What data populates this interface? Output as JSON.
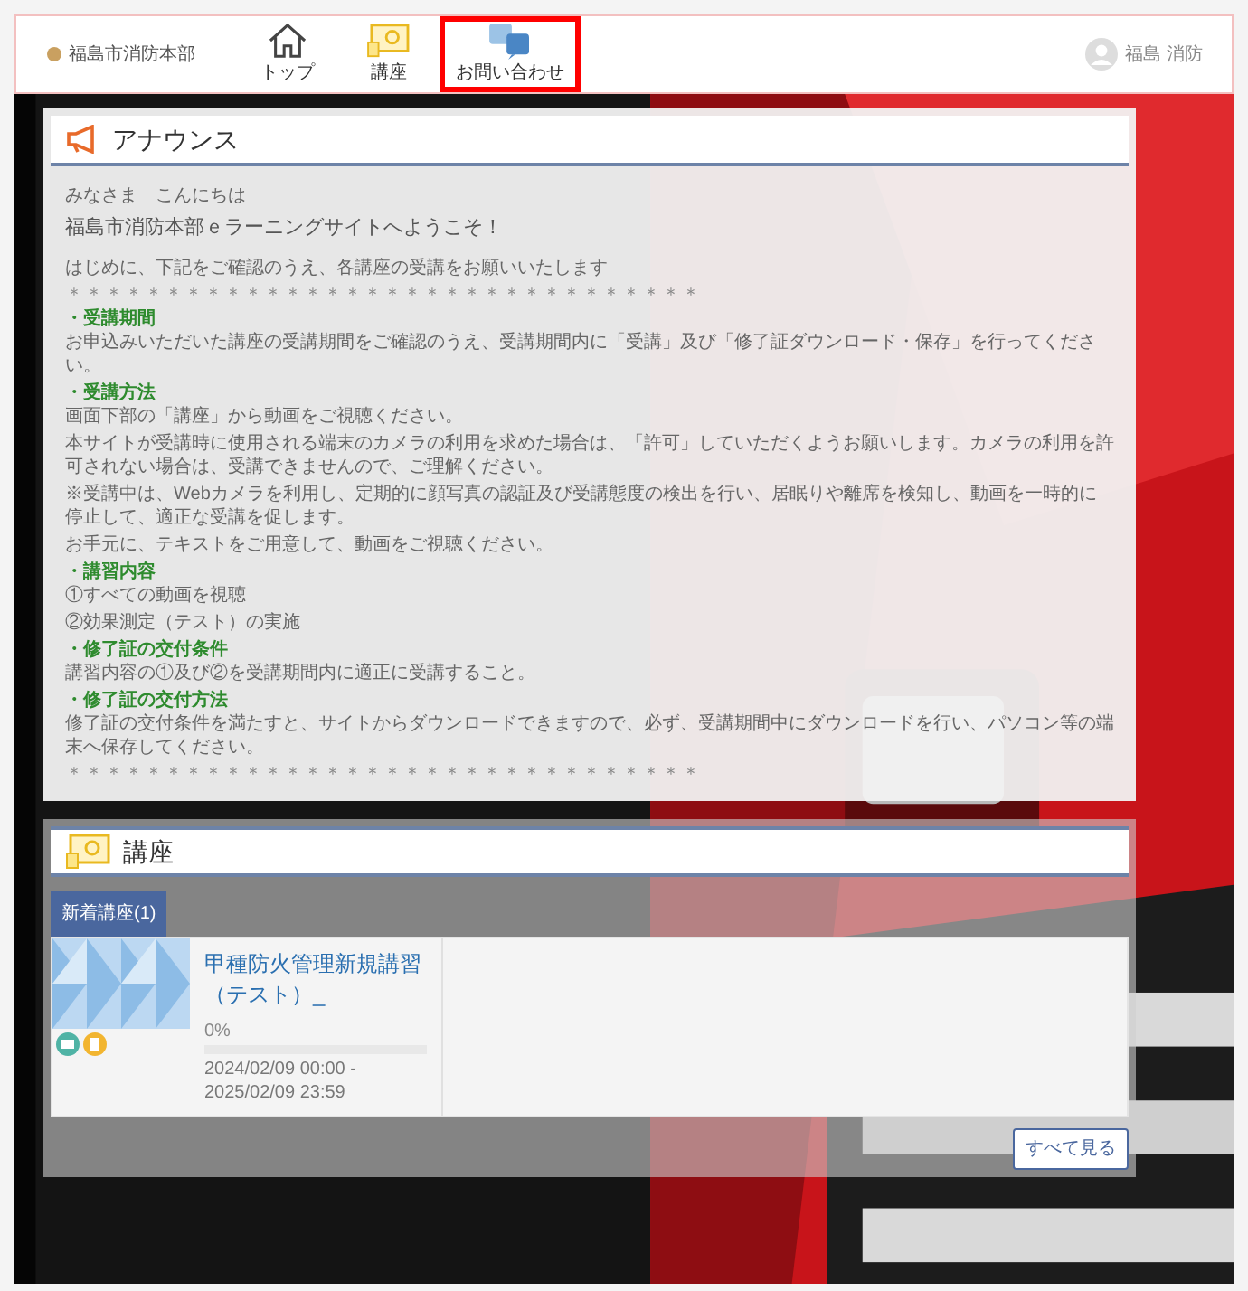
{
  "header": {
    "logo_text": "福島市消防本部",
    "nav": [
      {
        "label": "トップ",
        "kind": "home",
        "selected": false
      },
      {
        "label": "講座",
        "kind": "course",
        "selected": false
      },
      {
        "label": "お問い合わせ",
        "kind": "qa",
        "selected": true
      }
    ],
    "user": "福島 消防"
  },
  "announcement": {
    "title": "アナウンス",
    "blocks": [
      {
        "kind": "text",
        "text": "みなさま　こんにちは"
      },
      {
        "kind": "lead",
        "text": "福島市消防本部ｅラーニングサイトへようこそ！"
      },
      {
        "kind": "text",
        "text": "はじめに、下記をご確認のうえ、各講座の受講をお願いいたします"
      },
      {
        "kind": "stars",
        "text": "＊＊＊＊＊＊＊＊＊＊＊＊＊＊＊＊＊＊＊＊＊＊＊＊＊＊＊＊＊＊＊＊"
      },
      {
        "kind": "heading",
        "text": "・受講期間"
      },
      {
        "kind": "text",
        "text": "お申込みいただいた講座の受講期間をご確認のうえ、受講期間内に「受講」及び「修了証ダウンロード・保存」を行ってください。"
      },
      {
        "kind": "heading",
        "text": "・受講方法"
      },
      {
        "kind": "text",
        "text": "画面下部の「講座」から動画をご視聴ください。"
      },
      {
        "kind": "text",
        "text": "本サイトが受講時に使用される端末のカメラの利用を求めた場合は、「許可」していただくようお願いします。カメラの利用を許可されない場合は、受講できませんので、ご理解ください。"
      },
      {
        "kind": "text",
        "text": "※受講中は、Webカメラを利用し、定期的に顔写真の認証及び受講態度の検出を行い、居眠りや離席を検知し、動画を一時的に停止して、適正な受講を促します。"
      },
      {
        "kind": "text",
        "text": "お手元に、テキストをご用意して、動画をご視聴ください。"
      },
      {
        "kind": "heading",
        "text": "・講習内容"
      },
      {
        "kind": "text",
        "text": "①すべての動画を視聴"
      },
      {
        "kind": "text",
        "text": "②効果測定（テスト）の実施"
      },
      {
        "kind": "heading",
        "text": "・修了証の交付条件"
      },
      {
        "kind": "text",
        "text": "講習内容の①及び②を受講期間内に適正に受講すること。"
      },
      {
        "kind": "heading",
        "text": "・修了証の交付方法"
      },
      {
        "kind": "text",
        "text": "修了証の交付条件を満たすと、サイトからダウンロードできますので、必ず、受講期間中にダウンロードを行い、パソコン等の端末へ保存してください。"
      },
      {
        "kind": "stars",
        "text": "＊＊＊＊＊＊＊＊＊＊＊＊＊＊＊＊＊＊＊＊＊＊＊＊＊＊＊＊＊＊＊＊"
      }
    ]
  },
  "courses": {
    "title": "講座",
    "tabs": [
      {
        "label": "新着講座(1)",
        "selected": true
      }
    ],
    "items": [
      {
        "title": "甲種防火管理新規講習（テスト）_",
        "progress": "0%",
        "level": 0,
        "period": "2024/02/09 00:00 - 2025/02/09 23:59"
      }
    ],
    "view_all": "すべて見る"
  }
}
